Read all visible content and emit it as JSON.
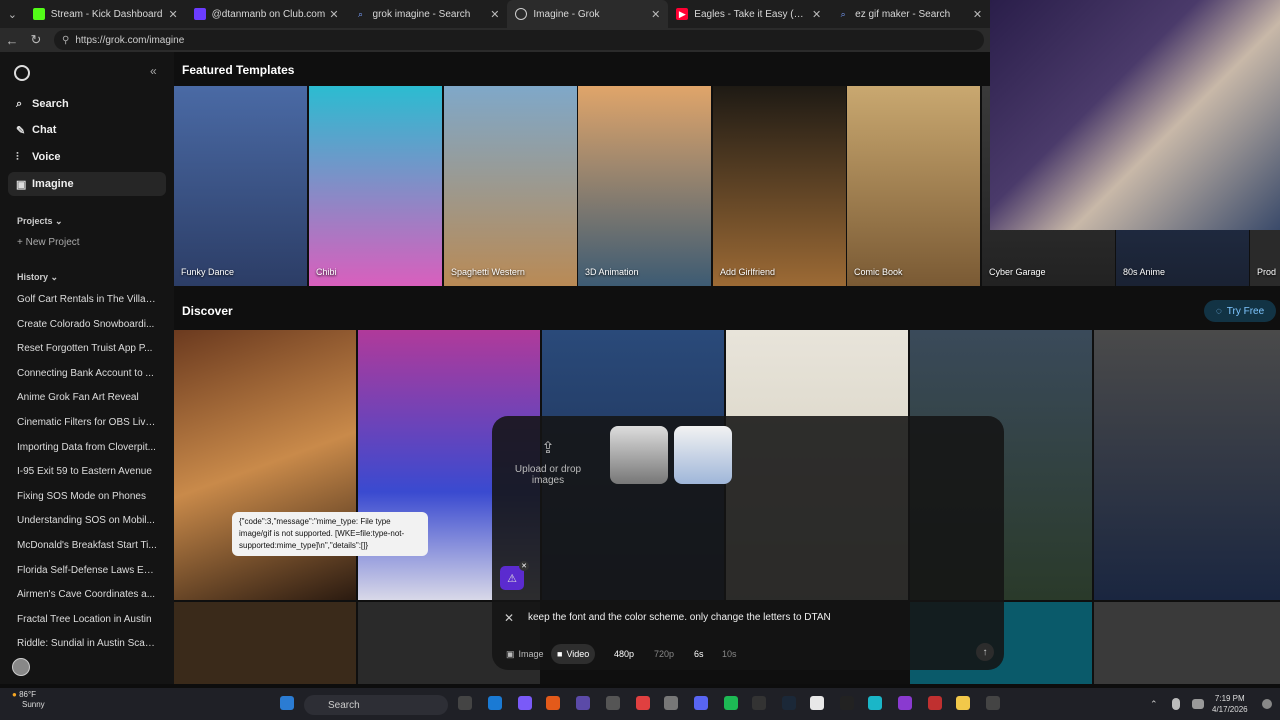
{
  "browser": {
    "tabs": [
      {
        "title": "Stream - Kick Dashboard",
        "color": "#53fc18"
      },
      {
        "title": "@dtanmanb on Club.com",
        "color": "#6b3cff"
      },
      {
        "title": "grok imagine - Search",
        "color": "#4a6cf7"
      },
      {
        "title": "Imagine - Grok",
        "color": "#888888"
      },
      {
        "title": "Eagles - Take it Easy (Official Audi...",
        "color": "#ff0033"
      },
      {
        "title": "ez gif maker - Search",
        "color": "#4a6cf7"
      }
    ],
    "url": "https://grok.com/imagine"
  },
  "sidebar": {
    "nav": [
      {
        "label": "Search",
        "icon": "search-icon"
      },
      {
        "label": "Chat",
        "icon": "chat-icon"
      },
      {
        "label": "Voice",
        "icon": "voice-icon"
      },
      {
        "label": "Imagine",
        "icon": "imagine-icon"
      }
    ],
    "projects_label": "Projects",
    "new_project": "New Project",
    "history_label": "History",
    "history": [
      "Golf Cart Rentals in The Villag...",
      "Create Colorado Snowboardi...",
      "Reset Forgotten Truist App P...",
      "Connecting Bank Account to ...",
      "Anime Grok Fan Art Reveal",
      "Cinematic Filters for OBS Live...",
      "Importing Data from Cloverpit...",
      "I-95 Exit 59 to Eastern Avenue",
      "Fixing SOS Mode on Phones",
      "Understanding SOS on Mobil...",
      "McDonald's Breakfast Start Ti...",
      "Florida Self-Defense Laws Ex...",
      "Airmen's Cave Coordinates a...",
      "Fractal Tree Location in Austin",
      "Riddle: Sundial in Austin Scav..."
    ]
  },
  "main": {
    "featured_title": "Featured Templates",
    "templates": [
      "Funky Dance",
      "Chibi",
      "Spaghetti Western",
      "3D Animation",
      "Add Girlfriend",
      "Comic Book",
      "Cyber Garage",
      "80s Anime",
      "Prod"
    ],
    "discover_title": "Discover",
    "try_free": "Try Free"
  },
  "composer": {
    "upload_text": "Upload or drop images",
    "error_text": "{\"code\":3,\"message\":\"mime_type: File type image/gif is not supported. [WKE=file:type-not-supported:mime_type]\\n\",\"details\":[]}",
    "prompt": "keep the font and the color scheme. only change the letters to DTAN",
    "mode_image": "Image",
    "mode_video": "Video",
    "res_480": "480p",
    "res_720": "720p",
    "dur_6": "6s",
    "dur_10": "10s"
  },
  "taskbar": {
    "temp": "86°F",
    "weather": "Sunny",
    "search": "Search",
    "time": "7:19 PM",
    "date": "4/17/2026"
  }
}
